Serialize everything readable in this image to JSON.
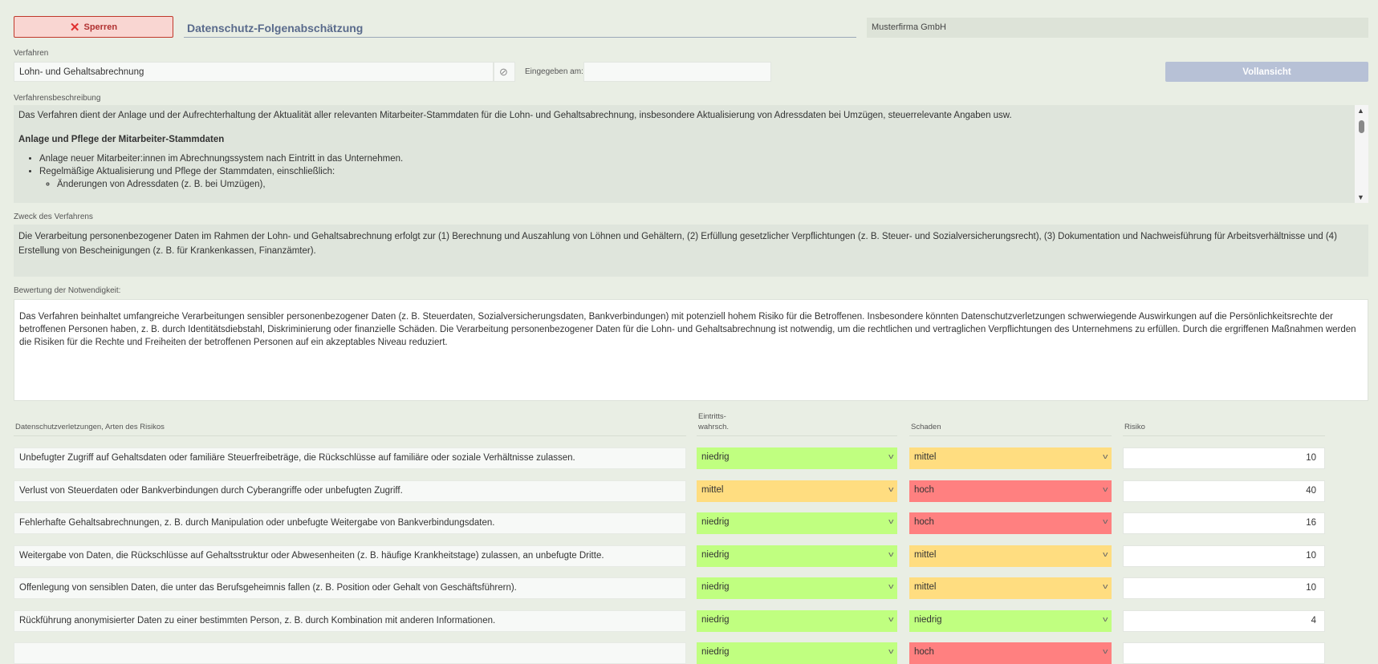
{
  "header": {
    "lock_label": "Sperren",
    "title": "Datenschutz-Folgenabschätzung",
    "company": "Musterfirma GmbH"
  },
  "verfahren": {
    "label": "Verfahren",
    "value": "Lohn- und Gehaltsabrechnung",
    "entered_label": "Eingegeben am:",
    "entered_value": "",
    "full_view_label": "Vollansicht"
  },
  "beschreibung": {
    "label": "Verfahrensbeschreibung",
    "intro": "Das Verfahren dient der Anlage und der Aufrechterhaltung der Aktualität aller relevanten Mitarbeiter-Stammdaten für die Lohn- und Gehaltsabrechnung, insbesondere Aktualisierung von Adressdaten bei Umzügen, steuerrelevante Angaben usw.",
    "heading": "Anlage und Pflege der Mitarbeiter-Stammdaten",
    "bullets": [
      "Anlage neuer Mitarbeiter:innen im Abrechnungssystem nach Eintritt in das Unternehmen.",
      "Regelmäßige Aktualisierung und Pflege der Stammdaten, einschließlich:"
    ],
    "sub_bullets": [
      "Änderungen von Adressdaten (z. B. bei Umzügen),"
    ]
  },
  "zweck": {
    "label": "Zweck des Verfahrens",
    "text": "Die Verarbeitung personenbezogener Daten im Rahmen der Lohn- und Gehaltsabrechnung erfolgt zur (1) Berechnung und Auszahlung von Löhnen und Gehältern, (2) Erfüllung gesetzlicher Verpflichtungen (z. B. Steuer- und Sozialversicherungsrecht), (3) Dokumentation und Nachweisführung für Arbeitsverhältnisse und (4) Erstellung von Bescheinigungen (z. B. für Krankenkassen, Finanzämter)."
  },
  "bewertung": {
    "label": "Bewertung der Notwendigkeit:",
    "text": "Das Verfahren beinhaltet umfangreiche Verarbeitungen sensibler personenbezogener Daten (z. B. Steuerdaten, Sozialversicherungsdaten, Bankverbindungen) mit potenziell hohem Risiko für die Betroffenen. Insbesondere könnten Datenschutzverletzungen schwerwiegende Auswirkungen auf die Persönlichkeitsrechte der betroffenen Personen haben, z. B. durch Identitätsdiebstahl, Diskriminierung oder finanzielle Schäden. Die Verarbeitung personenbezogener Daten für die Lohn- und Gehaltsabrechnung ist notwendig, um die rechtlichen und vertraglichen Verpflichtungen des Unternehmens zu erfüllen. Durch die ergriffenen Maßnahmen werden die Risiken für die Rechte und Freiheiten der betroffenen Personen auf ein akzeptables Niveau reduziert."
  },
  "table": {
    "headers": {
      "risk_type": "Datenschutzverletzungen, Arten des Risikos",
      "likelihood": "Eintritts-\nwahrsch.",
      "damage": "Schaden",
      "risk": "Risiko"
    },
    "colors": {
      "niedrig": "#c0ff80",
      "mittel": "#ffdd80",
      "hoch": "#ff8080"
    },
    "rows": [
      {
        "text": "Unbefugter Zugriff auf Gehaltsdaten oder familiäre Steuerfreibeträge, die Rückschlüsse auf familiäre oder soziale Verhältnisse zulassen.",
        "likelihood": "niedrig",
        "damage": "mittel",
        "risk": "10"
      },
      {
        "text": "Verlust von Steuerdaten oder Bankverbindungen durch Cyberangriffe oder unbefugten Zugriff.",
        "likelihood": "mittel",
        "damage": "hoch",
        "risk": "40"
      },
      {
        "text": "Fehlerhafte Gehaltsabrechnungen, z. B. durch Manipulation oder unbefugte Weitergabe von Bankverbindungsdaten.",
        "likelihood": "niedrig",
        "damage": "hoch",
        "risk": "16"
      },
      {
        "text": "Weitergabe von Daten, die Rückschlüsse auf Gehaltsstruktur oder Abwesenheiten (z. B. häufige Krankheitstage) zulassen, an unbefugte Dritte.",
        "likelihood": "niedrig",
        "damage": "mittel",
        "risk": "10"
      },
      {
        "text": "Offenlegung von sensiblen Daten, die unter das Berufsgeheimnis fallen (z. B. Position oder Gehalt von Geschäftsführern).",
        "likelihood": "niedrig",
        "damage": "mittel",
        "risk": "10"
      },
      {
        "text": "Rückführung anonymisierter Daten zu einer bestimmten Person, z. B. durch Kombination mit anderen Informationen.",
        "likelihood": "niedrig",
        "damage": "niedrig",
        "risk": "4"
      },
      {
        "text": "",
        "likelihood": "niedrig",
        "damage": "hoch",
        "risk": ""
      }
    ]
  }
}
